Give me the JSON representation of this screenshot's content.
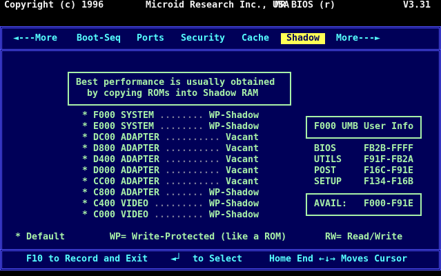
{
  "header": {
    "copyright": "Copyright (c) 1996",
    "company": "Microid Research Inc., USA",
    "product": "MR BIOS (r)",
    "version": "V3.31"
  },
  "menu": {
    "items": [
      {
        "label": "◄---More"
      },
      {
        "label": "Boot-Seq"
      },
      {
        "label": "Ports"
      },
      {
        "label": "Security"
      },
      {
        "label": "Cache"
      },
      {
        "label": "Shadow",
        "selected": true
      },
      {
        "label": "More---►"
      }
    ]
  },
  "info_box": {
    "line1": "Best performance is usually obtained",
    "line2": "by copying ROMs into Shadow RAM"
  },
  "shadow_list": [
    {
      "mark": "*",
      "segment": "F000 SYSTEM",
      "dots": "........",
      "value": "WP-Shadow"
    },
    {
      "mark": "*",
      "segment": "E000 SYSTEM",
      "dots": "........",
      "value": "WP-Shadow"
    },
    {
      "mark": "*",
      "segment": "DC00 ADAPTER",
      "dots": "..........",
      "value": "Vacant"
    },
    {
      "mark": "*",
      "segment": "D800 ADAPTER",
      "dots": "..........",
      "value": "Vacant"
    },
    {
      "mark": "*",
      "segment": "D400 ADAPTER",
      "dots": "..........",
      "value": "Vacant"
    },
    {
      "mark": "*",
      "segment": "D000 ADAPTER",
      "dots": "..........",
      "value": "Vacant"
    },
    {
      "mark": "*",
      "segment": "CC00 ADAPTER",
      "dots": "..........",
      "value": "Vacant"
    },
    {
      "mark": "*",
      "segment": "C800 ADAPTER",
      "dots": ".......",
      "value": "WP-Shadow"
    },
    {
      "mark": "*",
      "segment": "C400 VIDEO",
      "dots": ".........",
      "value": "WP-Shadow"
    },
    {
      "mark": "*",
      "segment": "C000 VIDEO",
      "dots": ".........",
      "value": "WP-Shadow"
    }
  ],
  "umb": {
    "title": "F000 UMB User Info",
    "rows": [
      {
        "label": "BIOS",
        "range": "FB2B-FFFF"
      },
      {
        "label": "UTILS",
        "range": "F91F-FB2A"
      },
      {
        "label": "POST",
        "range": "F16C-F91E"
      },
      {
        "label": "SETUP",
        "range": "F134-F16B"
      }
    ],
    "avail_label": "AVAIL:",
    "avail_range": "F000-F91E"
  },
  "legend": {
    "default": "* Default",
    "wp": "WP= Write-Protected (like a ROM)",
    "rw": "RW= Read/Write"
  },
  "footer": {
    "record": "F10 to Record and Exit",
    "enter_icon": "◄┘",
    "select": "to Select",
    "cursor": "Home End ←↓→ Moves Cursor"
  },
  "colors": {
    "background": "#000058",
    "border": "#5555ff",
    "text_green": "#a8f0a8",
    "menu_cyan": "#55ffff",
    "highlight": "#ffff55"
  }
}
